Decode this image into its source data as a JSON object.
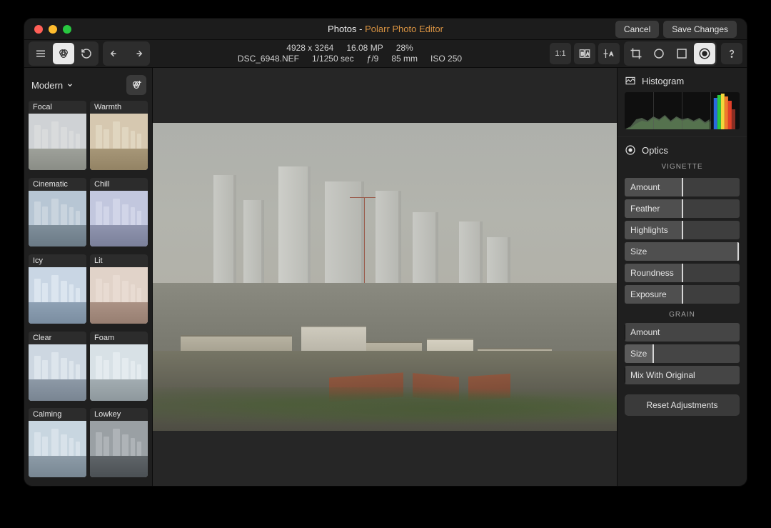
{
  "title": {
    "app": "Photos",
    "sep": " - ",
    "sub": "Polarr Photo Editor"
  },
  "titlebar": {
    "cancel": "Cancel",
    "save": "Save Changes"
  },
  "meta": {
    "dimensions": "4928 x 3264",
    "megapixels": "16.08 MP",
    "zoom": "28%",
    "filename": "DSC_6948.NEF",
    "shutter": "1/1250 sec",
    "aperture": "ƒ/9",
    "focal": "85 mm",
    "iso": "ISO 250"
  },
  "toolbar": {
    "ratio": "1:1"
  },
  "filters": {
    "category": "Modern",
    "items": [
      "Focal",
      "Warmth",
      "Cinematic",
      "Chill",
      "Icy",
      "Lit",
      "Clear",
      "Foam",
      "Calming",
      "Lowkey"
    ],
    "tints": {
      "Focal": {
        "sky": "#cfd2d5",
        "ground": "#9ea19a",
        "bld": "#d9dbdc"
      },
      "Warmth": {
        "sky": "#d6c8b0",
        "ground": "#a79778",
        "bld": "#e0d6c0"
      },
      "Cinematic": {
        "sky": "#b7c6d4",
        "ground": "#7f8e9a",
        "bld": "#c9d4de"
      },
      "Chill": {
        "sky": "#c2c7de",
        "ground": "#8f94ae",
        "bld": "#d1d5e8"
      },
      "Icy": {
        "sky": "#c9d6e4",
        "ground": "#8ea1b4",
        "bld": "#dbe5ef"
      },
      "Lit": {
        "sky": "#e1d3c9",
        "ground": "#ab9285",
        "bld": "#e8dbd2"
      },
      "Clear": {
        "sky": "#cdd7e1",
        "ground": "#8d99a6",
        "bld": "#dde5ec"
      },
      "Foam": {
        "sky": "#d8e1e6",
        "ground": "#a2acb1",
        "bld": "#e4ebef"
      },
      "Calming": {
        "sky": "#c8d6e0",
        "ground": "#8c9ba7",
        "bld": "#d8e2ea"
      },
      "Lowkey": {
        "sky": "#9aa0a4",
        "ground": "#5f6468",
        "bld": "#aeb3b7"
      }
    }
  },
  "right": {
    "histogram": "Histogram",
    "optics": "Optics",
    "vignette_label": "VIGNETTE",
    "grain_label": "GRAIN",
    "vignette": [
      {
        "name": "Amount",
        "pos": 50,
        "edge": 50
      },
      {
        "name": "Feather",
        "pos": 50,
        "edge": 50
      },
      {
        "name": "Highlights",
        "pos": 50,
        "edge": 50
      },
      {
        "name": "Size",
        "pos": 99,
        "edge": 99
      },
      {
        "name": "Roundness",
        "pos": 50,
        "edge": 50
      },
      {
        "name": "Exposure",
        "pos": 50,
        "edge": 50
      }
    ],
    "grain": [
      {
        "name": "Amount",
        "pos": 0,
        "edge": 0,
        "accent": true
      },
      {
        "name": "Size",
        "pos": 25,
        "edge": 25,
        "accent": true
      },
      {
        "name": "Mix With Original",
        "pos": 0,
        "edge": 0,
        "accent": true
      }
    ],
    "reset": "Reset Adjustments"
  }
}
